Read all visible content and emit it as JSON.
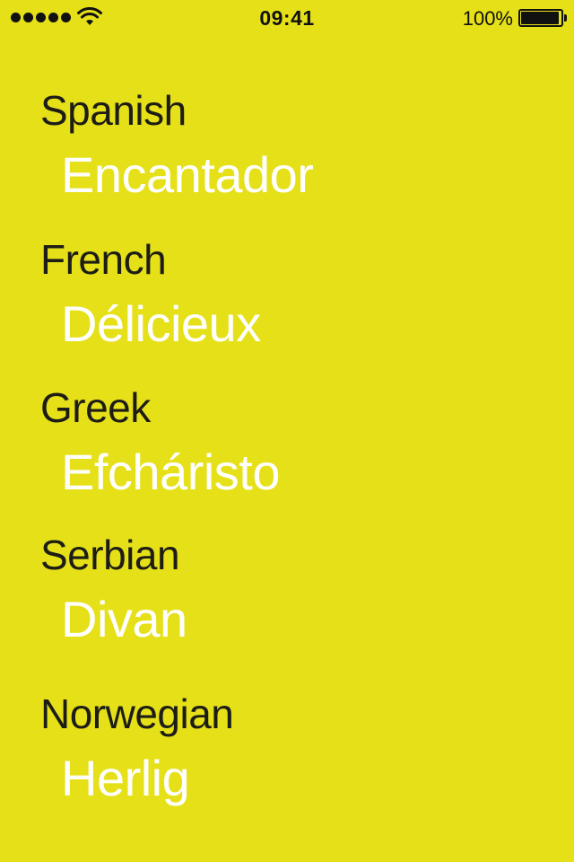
{
  "status_bar": {
    "signal_icon": "signal-strength-dots",
    "wifi_icon": "wifi-icon",
    "time": "09:41",
    "battery_percent": "100%",
    "battery_icon": "battery-full-icon",
    "battery_level": 1.0
  },
  "colors": {
    "background": "#e6e019",
    "language_text": "#1d1d16",
    "word_text": "#ffffff"
  },
  "entries": [
    {
      "language": "Spanish",
      "word": "Encantador"
    },
    {
      "language": "French",
      "word": "Délicieux"
    },
    {
      "language": "Greek",
      "word": "Efcháristo"
    },
    {
      "language": "Serbian",
      "word": "Divan"
    },
    {
      "language": "Norwegian",
      "word": "Herlig"
    }
  ]
}
